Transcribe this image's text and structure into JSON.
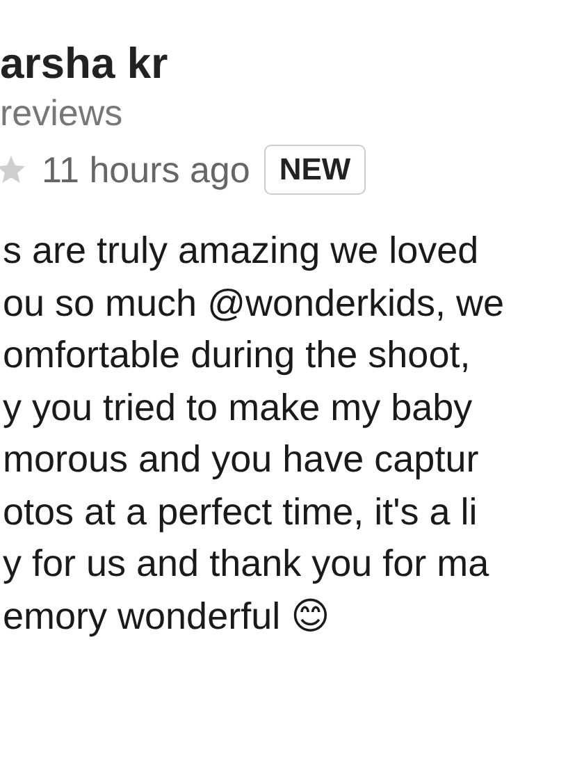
{
  "reviewer": {
    "name": "arsha kr",
    "reviews": "reviews"
  },
  "meta": {
    "time": "11 hours ago",
    "badge": "NEW"
  },
  "body_lines": [
    "s are truly amazing we loved",
    "ou so much @wonderkids, we",
    "omfortable during the shoot,",
    "y you tried to make my baby",
    "morous and you have captur",
    "otos at a perfect time, it's a li",
    "y for us and thank you for ma",
    "emory wonderful 😊"
  ]
}
